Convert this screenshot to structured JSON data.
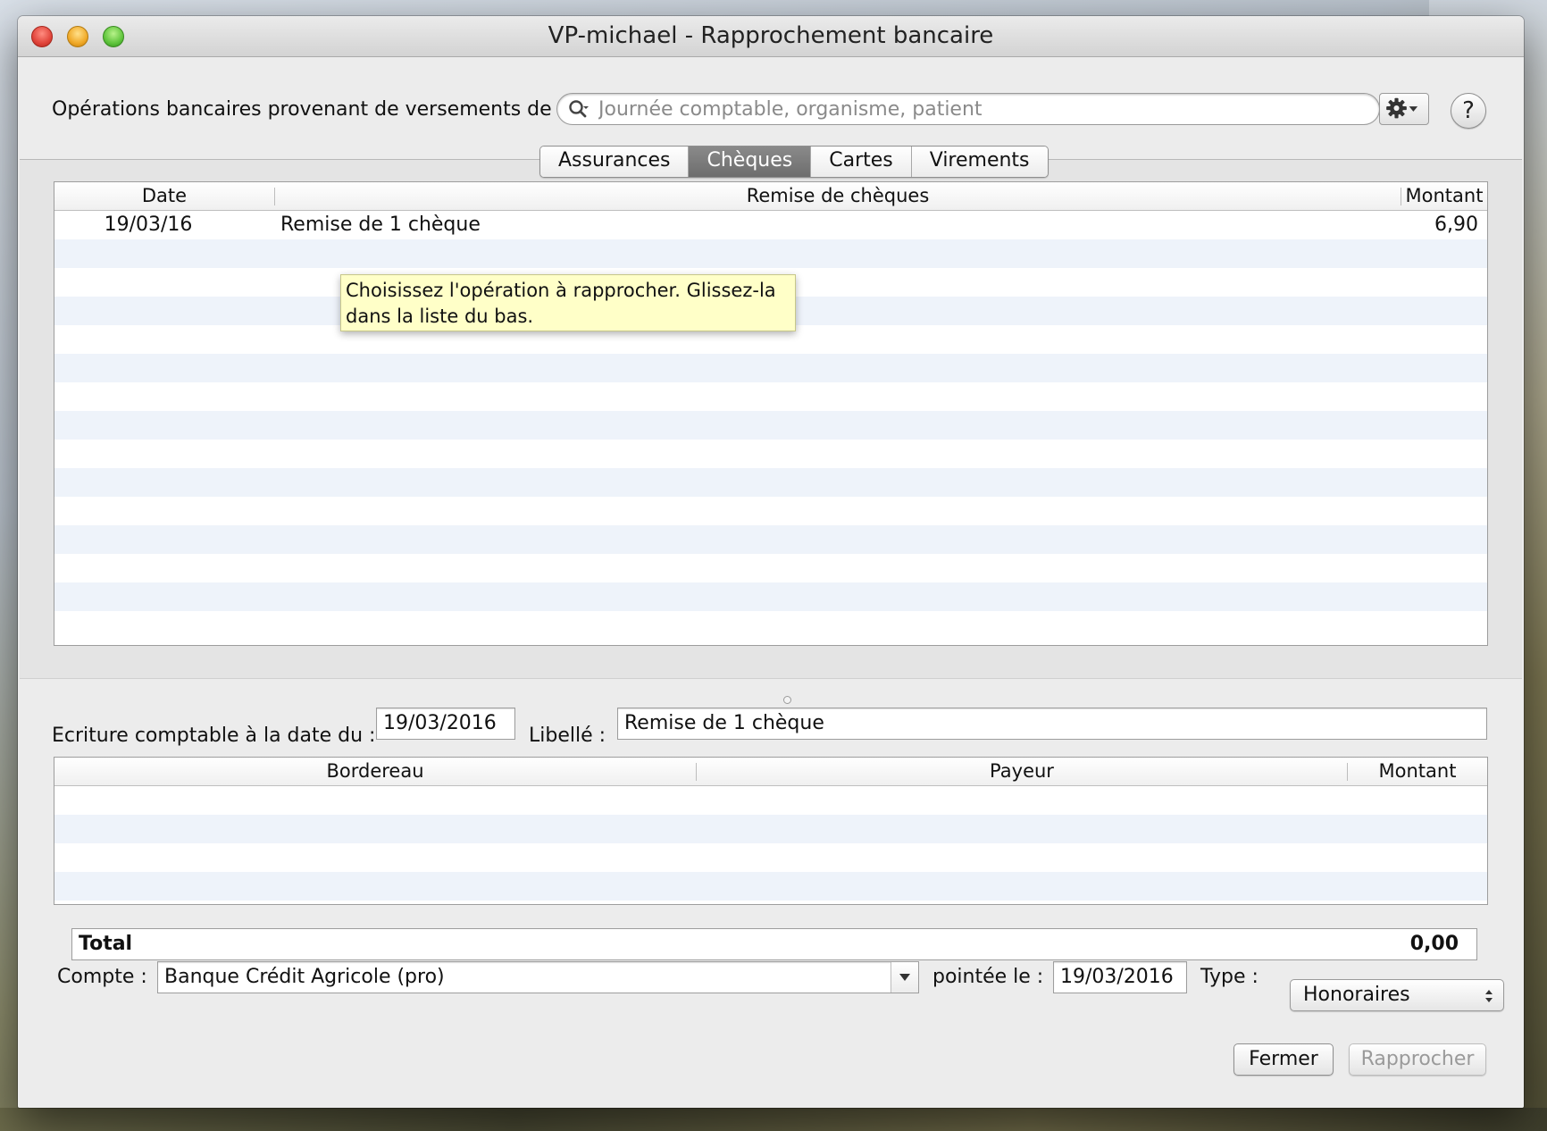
{
  "window": {
    "title": "VP-michael - Rapprochement bancaire"
  },
  "header": {
    "source_label": "Opérations bancaires provenant de versements de :",
    "search_placeholder": "Journée comptable, organisme, patient",
    "help_label": "?"
  },
  "tabs": [
    {
      "label": "Assurances",
      "active": false
    },
    {
      "label": "Chèques",
      "active": true
    },
    {
      "label": "Cartes",
      "active": false
    },
    {
      "label": "Virements",
      "active": false
    }
  ],
  "operations_table": {
    "columns": [
      "Date",
      "Remise de chèques",
      "Montant"
    ],
    "rows": [
      {
        "date": "19/03/16",
        "label": "Remise de 1 chèque",
        "amount": "6,90"
      }
    ]
  },
  "tooltip": {
    "text": "Choisissez l'opération à rapprocher. Glissez-la dans la liste du bas."
  },
  "entry": {
    "date_label": "Ecriture comptable à la date du :",
    "date_value": "19/03/2016",
    "libelle_label": "Libellé :",
    "libelle_value": "Remise de 1 chèque"
  },
  "detail_table": {
    "columns": [
      "Bordereau",
      "Payeur",
      "Montant"
    ],
    "rows": []
  },
  "total": {
    "label": "Total",
    "value": "0,00"
  },
  "footer": {
    "account_label": "Compte :",
    "account_value": "Banque Crédit Agricole (pro)",
    "pointed_label": "pointée le :",
    "pointed_value": "19/03/2016",
    "type_label": "Type :",
    "type_value": "Honoraires",
    "close_button": "Fermer",
    "reconcile_button": "Rapprocher"
  },
  "colors": {
    "tooltip_bg": "#ffffc8",
    "row_stripe": "#eef3fa",
    "active_tab": "#7a7a7a"
  }
}
